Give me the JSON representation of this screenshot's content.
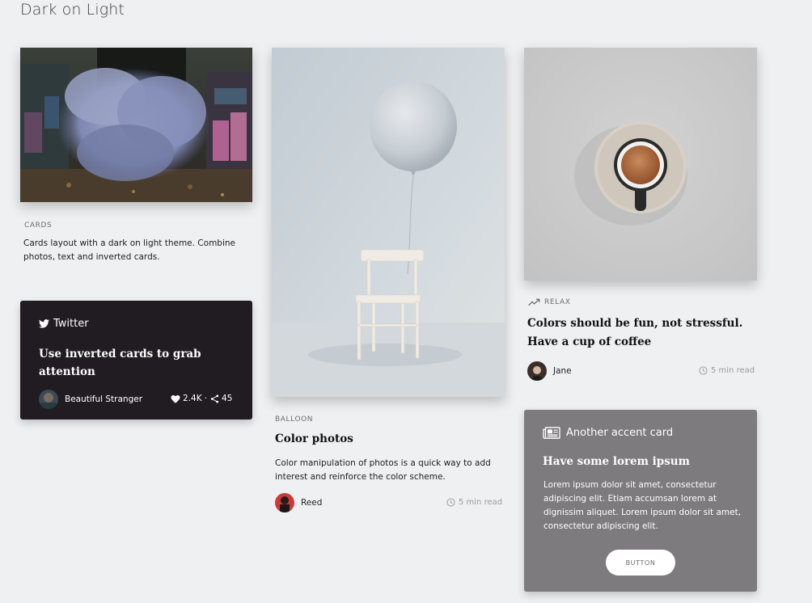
{
  "page": {
    "title": "Dark on Light"
  },
  "cards_intro": {
    "eyebrow": "CARDS",
    "text": "Cards layout with a dark on light theme. Combine photos, text and inverted cards."
  },
  "twitter_card": {
    "brand": "Twitter",
    "brand_icon": "twitter-bird-icon",
    "headline": "Use inverted cards to grab attention",
    "author": "Beautiful Stranger",
    "likes": "2.4K",
    "separator": "·",
    "shares": "45",
    "like_icon": "heart-icon",
    "share_icon": "share-icon"
  },
  "balloon_card": {
    "eyebrow": "BALLOON",
    "title": "Color photos",
    "text": "Color manipulation of photos is a quick way to add interest and reinforce the color scheme.",
    "author": "Reed",
    "read_time": "5 min read"
  },
  "relax_card": {
    "eyebrow": "RELAX",
    "eyebrow_icon": "trending-up-icon",
    "title": "Colors should be fun, not stressful. Have a cup of coffee",
    "author": "Jane",
    "read_time": "5 min read"
  },
  "accent_card": {
    "label": "Another accent card",
    "label_icon": "newspaper-icon",
    "title": "Have some lorem ipsum",
    "text": "Lorem ipsum dolor sit amet, consectetur adipiscing elit. Etiam accumsan lorem at dignissim aliquet. Lorem ipsum dolor sit amet, consectetur adipiscing elit.",
    "button": "BUTTON"
  },
  "colors": {
    "background": "#eff0f2",
    "inverted_card": "#211c21",
    "accent_card": "#7d7b7d"
  }
}
